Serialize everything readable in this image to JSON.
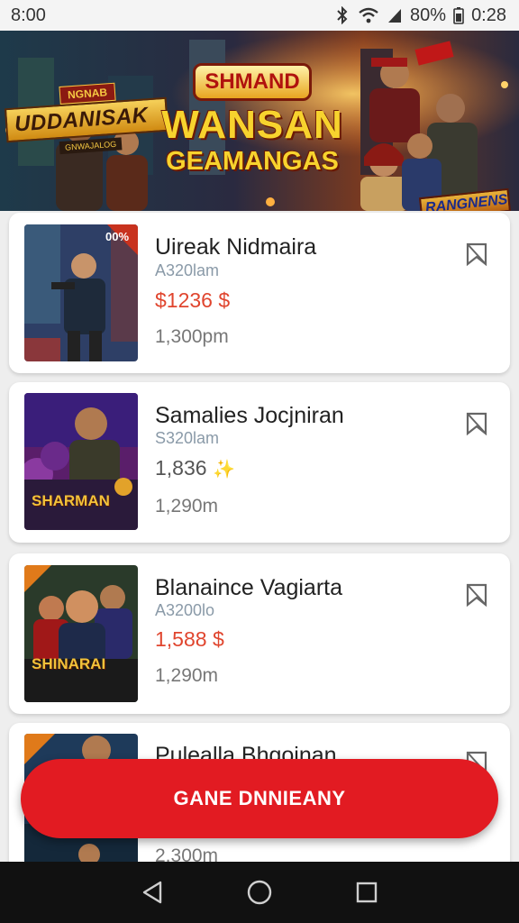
{
  "status_bar": {
    "time_left": "8:00",
    "battery": "80%",
    "time_right": "0:28"
  },
  "banner": {
    "logo_top": "NGNAB",
    "logo_main": "UDDANISAK",
    "logo_sub": "GNWAJALOG",
    "title_top": "SHMAND",
    "title_line1": "WANSAN",
    "title_line2": "GEAMANGAS",
    "badge": "RANGNENS"
  },
  "games": [
    {
      "title": "Uireak Nidmaira",
      "subtitle": "A320lam",
      "price": "$1236 $",
      "price_style": "red",
      "meta": "1,300pm",
      "thumb_badge": "00%",
      "thumb_colors": [
        "#2e3f66",
        "#c8321e"
      ]
    },
    {
      "title": "Samalies Jocjniran",
      "subtitle": "S320lam",
      "price": "1,836",
      "price_style": "grey",
      "meta": "1,290m",
      "thumb_caption": "SHARMAN",
      "thumb_colors": [
        "#5a1e6a",
        "#e2a22a"
      ]
    },
    {
      "title": "Blanaince Vagiarta",
      "subtitle": "A3200lo",
      "price": "1,588 $",
      "price_style": "red",
      "meta": "1,290m",
      "thumb_caption": "SHINARAI",
      "thumb_colors": [
        "#2a3a2a",
        "#e07a1a"
      ]
    },
    {
      "title": "Pulealla Bhgoinan",
      "subtitle": "",
      "price": "",
      "price_style": "grey",
      "meta": "2,300m",
      "thumb_colors": [
        "#1e3a5a",
        "#e07a1a"
      ]
    }
  ],
  "cta_label": "GANE DNNIEANY",
  "colors": {
    "accent": "#e21b22",
    "price_red": "#e0452e",
    "subtitle": "#8a9aa8"
  },
  "icons": {
    "bookmark": "bookmark-icon",
    "back": "back-icon",
    "home": "home-icon",
    "recents": "recents-icon"
  }
}
